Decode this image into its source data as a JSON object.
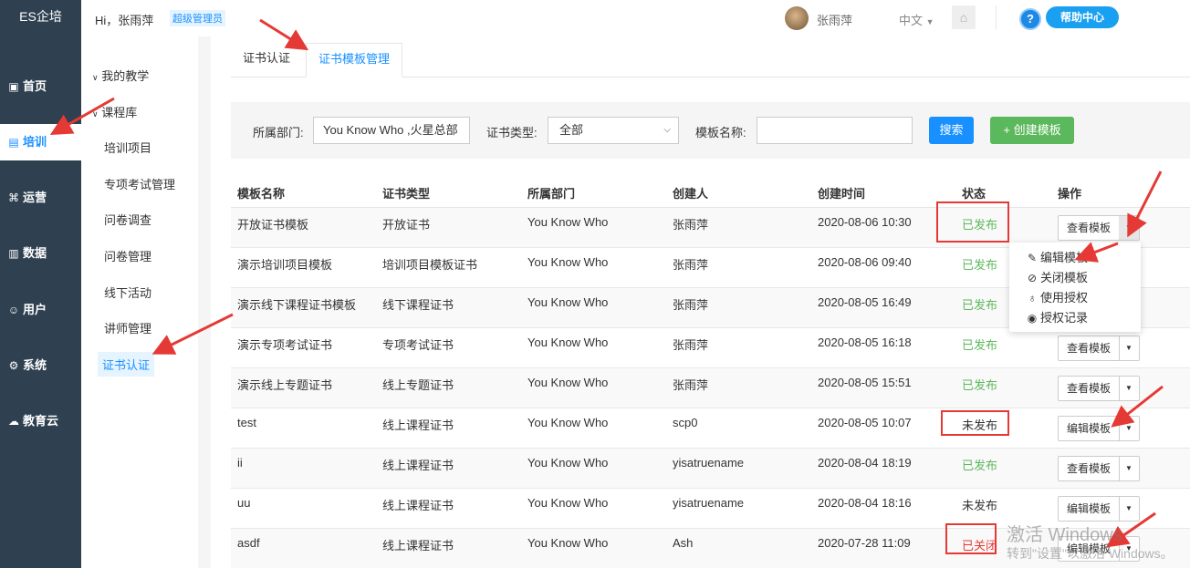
{
  "app": {
    "logo": "ES企培"
  },
  "topbar": {
    "greeting": "Hi，张雨萍",
    "role_badge": "超级管理员",
    "user_name": "张雨萍",
    "language": "中文",
    "help_label": "帮助中心"
  },
  "sidebar": {
    "items": [
      {
        "label": "首页",
        "icon": "dashboard-icon"
      },
      {
        "label": "培训",
        "icon": "book-icon",
        "active": true
      },
      {
        "label": "运营",
        "icon": "command-icon"
      },
      {
        "label": "数据",
        "icon": "bar-chart-icon"
      },
      {
        "label": "用户",
        "icon": "users-icon"
      },
      {
        "label": "系统",
        "icon": "gear-icon"
      },
      {
        "label": "教育云",
        "icon": "cloud-icon"
      }
    ]
  },
  "subnav": {
    "groups": [
      "我的教学",
      "课程库"
    ],
    "items": [
      "培训项目",
      "专项考试管理",
      "问卷调查",
      "问卷管理",
      "线下活动",
      "讲师管理",
      "证书认证"
    ],
    "active": "证书认证"
  },
  "tabs": [
    "证书认证",
    "证书模板管理"
  ],
  "active_tab": "证书模板管理",
  "filters": {
    "dept_label": "所属部门:",
    "dept_value": "You Know Who ,火星总部",
    "type_label": "证书类型:",
    "type_value": "全部",
    "name_label": "模板名称:",
    "name_value": "",
    "search_label": "搜索",
    "create_label": "+ 创建模板"
  },
  "table": {
    "headers": [
      "模板名称",
      "证书类型",
      "所属部门",
      "创建人",
      "创建时间",
      "状态",
      "操作"
    ],
    "rows": [
      {
        "name": "开放证书模板",
        "type": "开放证书",
        "dept": "You Know Who",
        "creator": "张雨萍",
        "time": "2020-08-06 10:30",
        "status": "已发布",
        "status_kind": "published",
        "action": "查看模板"
      },
      {
        "name": "演示培训项目模板",
        "type": "培训项目模板证书",
        "dept": "You Know Who",
        "creator": "张雨萍",
        "time": "2020-08-06 09:40",
        "status": "已发布",
        "status_kind": "published",
        "action": "查看模板"
      },
      {
        "name": "演示线下课程证书模板",
        "type": "线下课程证书",
        "dept": "You Know Who",
        "creator": "张雨萍",
        "time": "2020-08-05 16:49",
        "status": "已发布",
        "status_kind": "published",
        "action": "查看模板"
      },
      {
        "name": "演示专项考试证书",
        "type": "专项考试证书",
        "dept": "You Know Who",
        "creator": "张雨萍",
        "time": "2020-08-05 16:18",
        "status": "已发布",
        "status_kind": "published",
        "action": "查看模板"
      },
      {
        "name": "演示线上专题证书",
        "type": "线上专题证书",
        "dept": "You Know Who",
        "creator": "张雨萍",
        "time": "2020-08-05 15:51",
        "status": "已发布",
        "status_kind": "published",
        "action": "查看模板"
      },
      {
        "name": "test",
        "type": "线上课程证书",
        "dept": "You Know Who",
        "creator": "scp0",
        "time": "2020-08-05 10:07",
        "status": "未发布",
        "status_kind": "unpublished",
        "action": "编辑模板"
      },
      {
        "name": "ii",
        "type": "线上课程证书",
        "dept": "You Know Who",
        "creator": "yisatruename",
        "time": "2020-08-04 18:19",
        "status": "已发布",
        "status_kind": "published",
        "action": "查看模板"
      },
      {
        "name": "uu",
        "type": "线上课程证书",
        "dept": "You Know Who",
        "creator": "yisatruename",
        "time": "2020-08-04 18:16",
        "status": "未发布",
        "status_kind": "unpublished",
        "action": "编辑模板"
      },
      {
        "name": "asdf",
        "type": "线上课程证书",
        "dept": "You Know Who",
        "creator": "Ash",
        "time": "2020-07-28 11:09",
        "status": "已关闭",
        "status_kind": "closed",
        "action": "编辑模板"
      }
    ]
  },
  "dropdown_menu": [
    {
      "label": "编辑模板",
      "icon": "edit-icon"
    },
    {
      "label": "关闭模板",
      "icon": "ban-icon"
    },
    {
      "label": "使用授权",
      "icon": "user-icon"
    },
    {
      "label": "授权记录",
      "icon": "eye-icon"
    }
  ],
  "watermark": {
    "line1": "激活 Windows",
    "line2": "转到\"设置\"以激活 Windows。"
  },
  "colors": {
    "sidebar": "#2f4050",
    "accent": "#1890ff",
    "published": "#5cb85c",
    "closed": "#e53935",
    "annotation": "#e53935"
  }
}
